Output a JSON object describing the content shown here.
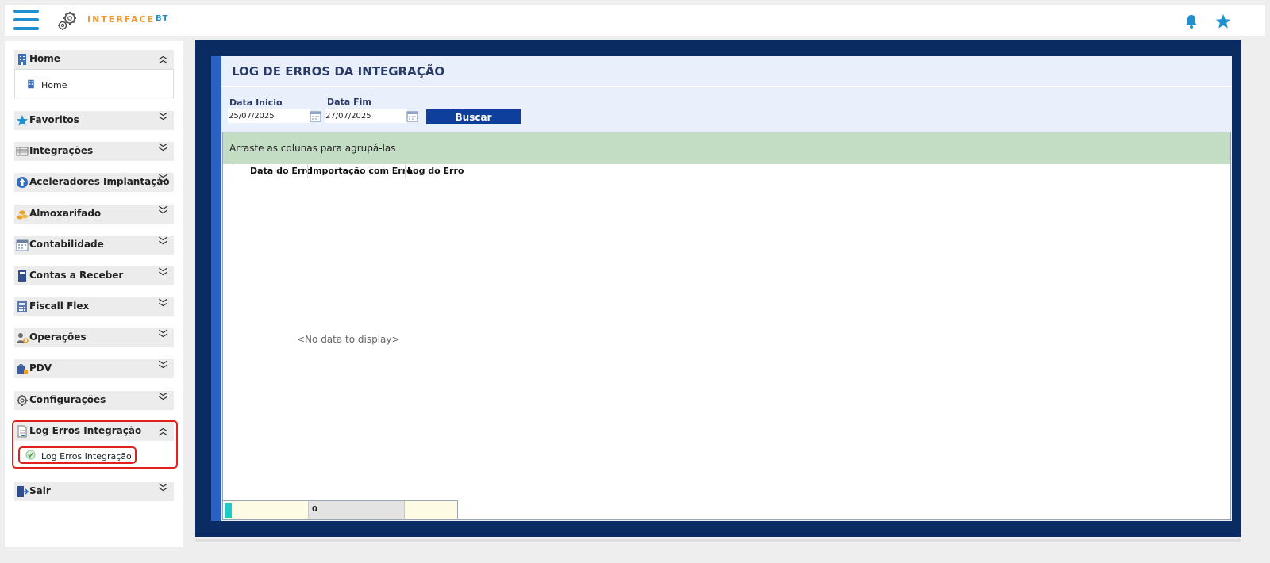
{
  "app": {
    "brand_text": "INTERFACE",
    "brand_suffix": "BT",
    "colors": {
      "accent": "#1f8fcf",
      "brand_orange": "#f0972f",
      "frame": "#0b2b63",
      "button": "#0f3f9d",
      "highlight": "#e0211c"
    }
  },
  "topbar": {
    "icons": [
      "menu-icon",
      "bell-icon",
      "star-icon"
    ]
  },
  "sidebar": {
    "home": {
      "label": "Home",
      "icon": "building-icon",
      "expanded": true,
      "sub_label": "Home"
    },
    "items": [
      {
        "label": "Favoritos",
        "icon": "star-icon"
      },
      {
        "label": "Integrações",
        "icon": "table-icon"
      },
      {
        "label": "Aceleradores Implantação",
        "icon": "arrow-up-circle-icon"
      },
      {
        "label": "Almoxarifado",
        "icon": "coins-icon"
      },
      {
        "label": "Contabilidade",
        "icon": "calendar-icon"
      },
      {
        "label": "Contas a Receber",
        "icon": "book-icon"
      },
      {
        "label": "Fiscall Flex",
        "icon": "calculator-icon"
      },
      {
        "label": "Operações",
        "icon": "user-gear-icon"
      },
      {
        "label": "PDV",
        "icon": "shopping-bag-icon"
      },
      {
        "label": "Configurações",
        "icon": "gear-icon"
      }
    ],
    "log": {
      "label": "Log Erros Integração",
      "icon": "document-icon",
      "expanded": true,
      "sub_label": "Log Erros Integração",
      "sub_icon": "check-circle-icon"
    },
    "sair": {
      "label": "Sair",
      "icon": "exit-door-icon"
    }
  },
  "main": {
    "title": "LOG DE ERROS DA INTEGRAÇÃO",
    "filters": {
      "start_label": "Data Inicio",
      "start_value": "25/07/2025",
      "end_label": "Data Fim",
      "end_value": "27/07/2025",
      "search_button": "Buscar"
    },
    "grid": {
      "group_hint": "Arraste as colunas para agrupá-las",
      "columns": [
        "Data do Erro",
        "Importação com Erro",
        "Log do Erro"
      ],
      "empty_text": "<No data to display>",
      "footer_count": "0"
    }
  }
}
